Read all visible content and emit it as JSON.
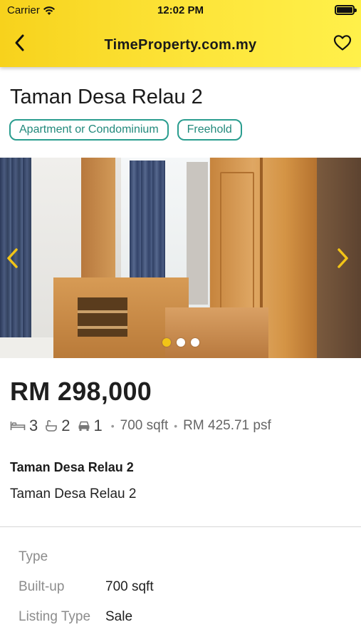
{
  "status_bar": {
    "carrier": "Carrier",
    "time": "12:02 PM"
  },
  "nav": {
    "title": "TimeProperty.com.my",
    "back_icon": "chevron-left-icon",
    "favorite_icon": "heart-outline-icon"
  },
  "listing": {
    "title": "Taman Desa Relau 2",
    "tags": [
      "Apartment or Condominium",
      "Freehold"
    ],
    "gallery": {
      "image_count": 3,
      "active_index": 0
    },
    "price": "RM 298,000",
    "specs": {
      "bedrooms": "3",
      "bathrooms": "2",
      "parking": "1",
      "size": "700 sqft",
      "price_psf": "RM 425.71 psf"
    },
    "name": "Taman Desa Relau 2",
    "address": "Taman Desa Relau 2"
  },
  "details": [
    {
      "label": "Type",
      "value": ""
    },
    {
      "label": "Built-up",
      "value": "700 sqft"
    },
    {
      "label": "Listing Type",
      "value": "Sale"
    }
  ],
  "colors": {
    "header_yellow": "#fde53a",
    "tag_teal": "#2a9d8f",
    "active_dot": "#f2c417",
    "arrow_yellow": "#f2c417"
  }
}
